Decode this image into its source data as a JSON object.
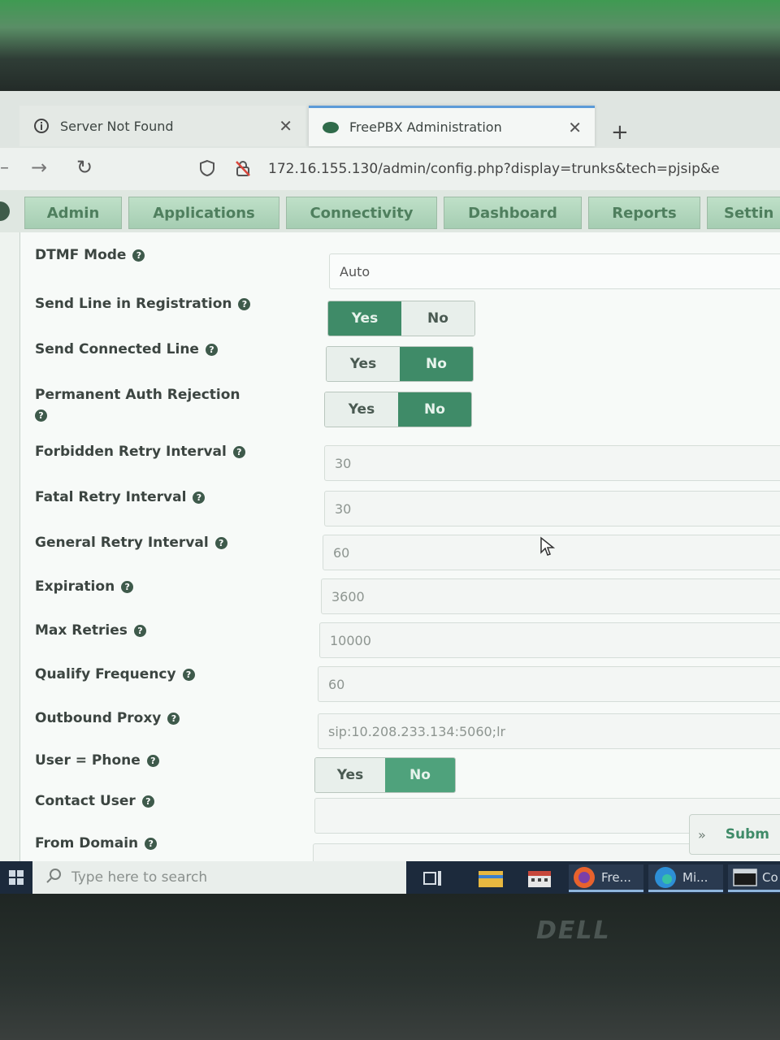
{
  "browser": {
    "tabs": [
      {
        "label": "Server Not Found",
        "icon": "info-icon"
      },
      {
        "label": "FreePBX Administration",
        "icon": "freepbx-icon"
      }
    ],
    "new_tab": "+",
    "url": "172.16.155.130/admin/config.php?display=trunks&tech=pjsip&e"
  },
  "menu": {
    "items": [
      "Admin",
      "Applications",
      "Connectivity",
      "Dashboard",
      "Reports",
      "Settin"
    ]
  },
  "form": {
    "dtmf_mode": {
      "label": "DTMF Mode",
      "value": "Auto"
    },
    "send_line_in_registration": {
      "label": "Send Line in Registration",
      "selected": "Yes"
    },
    "send_connected_line": {
      "label": "Send Connected Line",
      "selected": "No"
    },
    "permanent_auth_rejection": {
      "label": "Permanent Auth Rejection",
      "selected": "No"
    },
    "forbidden_retry_interval": {
      "label": "Forbidden Retry Interval",
      "value": "30"
    },
    "fatal_retry_interval": {
      "label": "Fatal Retry Interval",
      "value": "30"
    },
    "general_retry_interval": {
      "label": "General Retry Interval",
      "value": "60"
    },
    "expiration": {
      "label": "Expiration",
      "value": "3600"
    },
    "max_retries": {
      "label": "Max Retries",
      "value": "10000"
    },
    "qualify_frequency": {
      "label": "Qualify Frequency",
      "value": "60"
    },
    "outbound_proxy": {
      "label": "Outbound Proxy",
      "value": "sip:10.208.233.134:5060;lr"
    },
    "user_phone": {
      "label": "User = Phone",
      "selected": "No"
    },
    "contact_user": {
      "label": "Contact User",
      "value": ""
    },
    "from_domain": {
      "label": "From Domain",
      "value": ""
    },
    "yes_label": "Yes",
    "no_label": "No"
  },
  "submit": {
    "chevron": "»",
    "label": "Subm"
  },
  "taskbar": {
    "search_placeholder": "Type here to search",
    "apps": [
      {
        "label": "Fre...",
        "icon": "firefox-icon"
      },
      {
        "label": "Mi...",
        "icon": "edge-icon"
      },
      {
        "label": "Co",
        "icon": "terminal-icon"
      }
    ]
  },
  "hardware": {
    "brand": "DELL"
  },
  "colors": {
    "accent": "#3f8b68",
    "menu_text": "#4f7f5e"
  }
}
